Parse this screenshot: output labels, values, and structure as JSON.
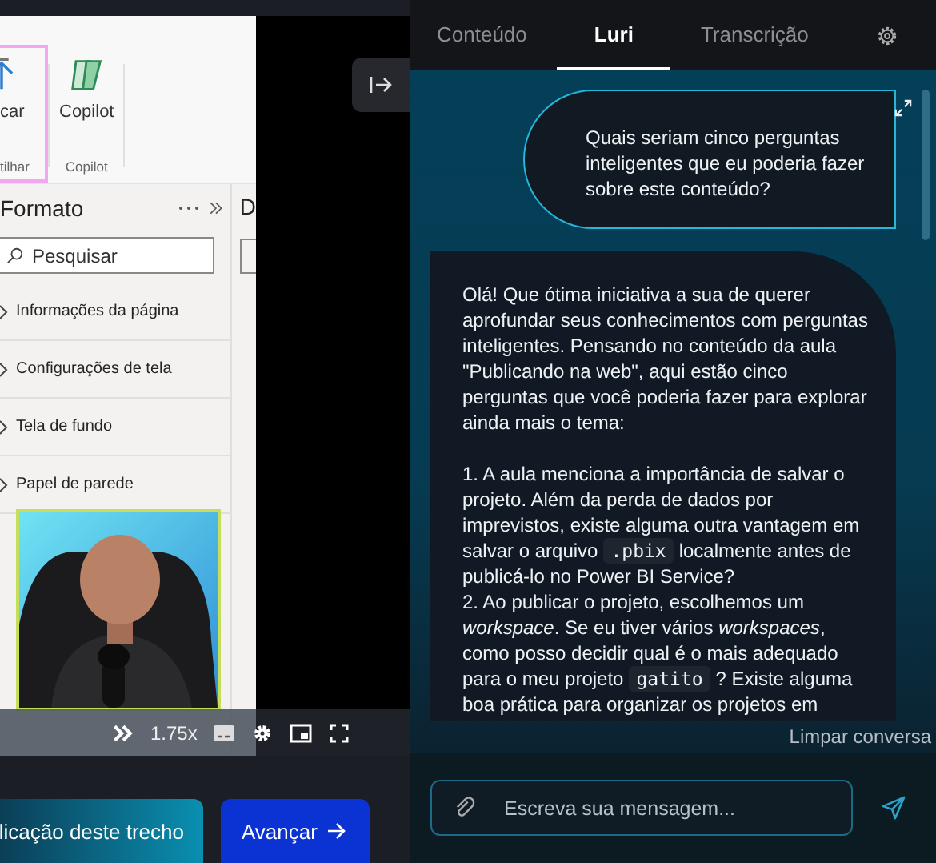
{
  "video": {
    "ribbon": {
      "buttons": [
        {
          "label": "car",
          "kind": "upload",
          "highlighted": true
        },
        {
          "label": "Copilot",
          "kind": "copilot",
          "highlighted": false
        }
      ],
      "groups": [
        {
          "label": "tilhar"
        },
        {
          "label": "Copilot"
        }
      ]
    },
    "format_pane": {
      "title": "Formato",
      "search": {
        "placeholder": "Pesquisar"
      },
      "sections": [
        {
          "label": "Informações da página"
        },
        {
          "label": "Configurações de tela"
        },
        {
          "label": "Tela de fundo"
        },
        {
          "label": "Papel de parede"
        }
      ],
      "next_pane_title": "D"
    },
    "controls": {
      "speed": "1.75x"
    }
  },
  "lesson_buttons": [
    {
      "label": "licação deste trecho",
      "kind": "secondary"
    },
    {
      "label": "Avançar",
      "kind": "primary"
    }
  ],
  "tabs": [
    {
      "label": "Conteúdo",
      "selected": false
    },
    {
      "label": "Luri",
      "selected": true
    },
    {
      "label": "Transcrição",
      "selected": false
    }
  ],
  "chat": {
    "messages": [
      {
        "kind": "user",
        "paragraphs": [
          [
            {
              "kind": "text",
              "text": "Quais seriam cinco perguntas inteligentes que eu poderia fazer sobre este conteúdo?"
            }
          ]
        ]
      },
      {
        "kind": "assistant",
        "paragraphs": [
          [
            {
              "kind": "text",
              "text": "Olá! Que ótima iniciativa a sua de querer aprofundar seus conhecimentos com perguntas inteligentes. Pensando no conteúdo da aula \"Publicando na web\", aqui estão cinco perguntas que você poderia fazer para explorar ainda mais o tema:"
            }
          ],
          [
            {
              "kind": "text",
              "text": "1. A aula menciona a importância de salvar o projeto. Além da perda de dados por imprevistos, existe alguma outra vantagem em salvar o arquivo"
            },
            {
              "kind": "code",
              "text": ".pbix"
            },
            {
              "kind": "text",
              "text": "localmente antes de publicá-lo no Power BI Service?"
            }
          ],
          [
            {
              "kind": "text",
              "text": "2. Ao publicar o projeto, escolhemos um *workspace*. Se eu tiver vários *workspaces*, como posso decidir qual é o mais adequado para o meu projeto"
            },
            {
              "kind": "code",
              "text": "gatito"
            },
            {
              "kind": "text",
              "text": "? Existe alguma boa prática para organizar os projetos em"
            }
          ]
        ]
      }
    ],
    "clear_label": "Limpar conversa",
    "input": {
      "placeholder": "Escreva sua mensagem..."
    }
  }
}
